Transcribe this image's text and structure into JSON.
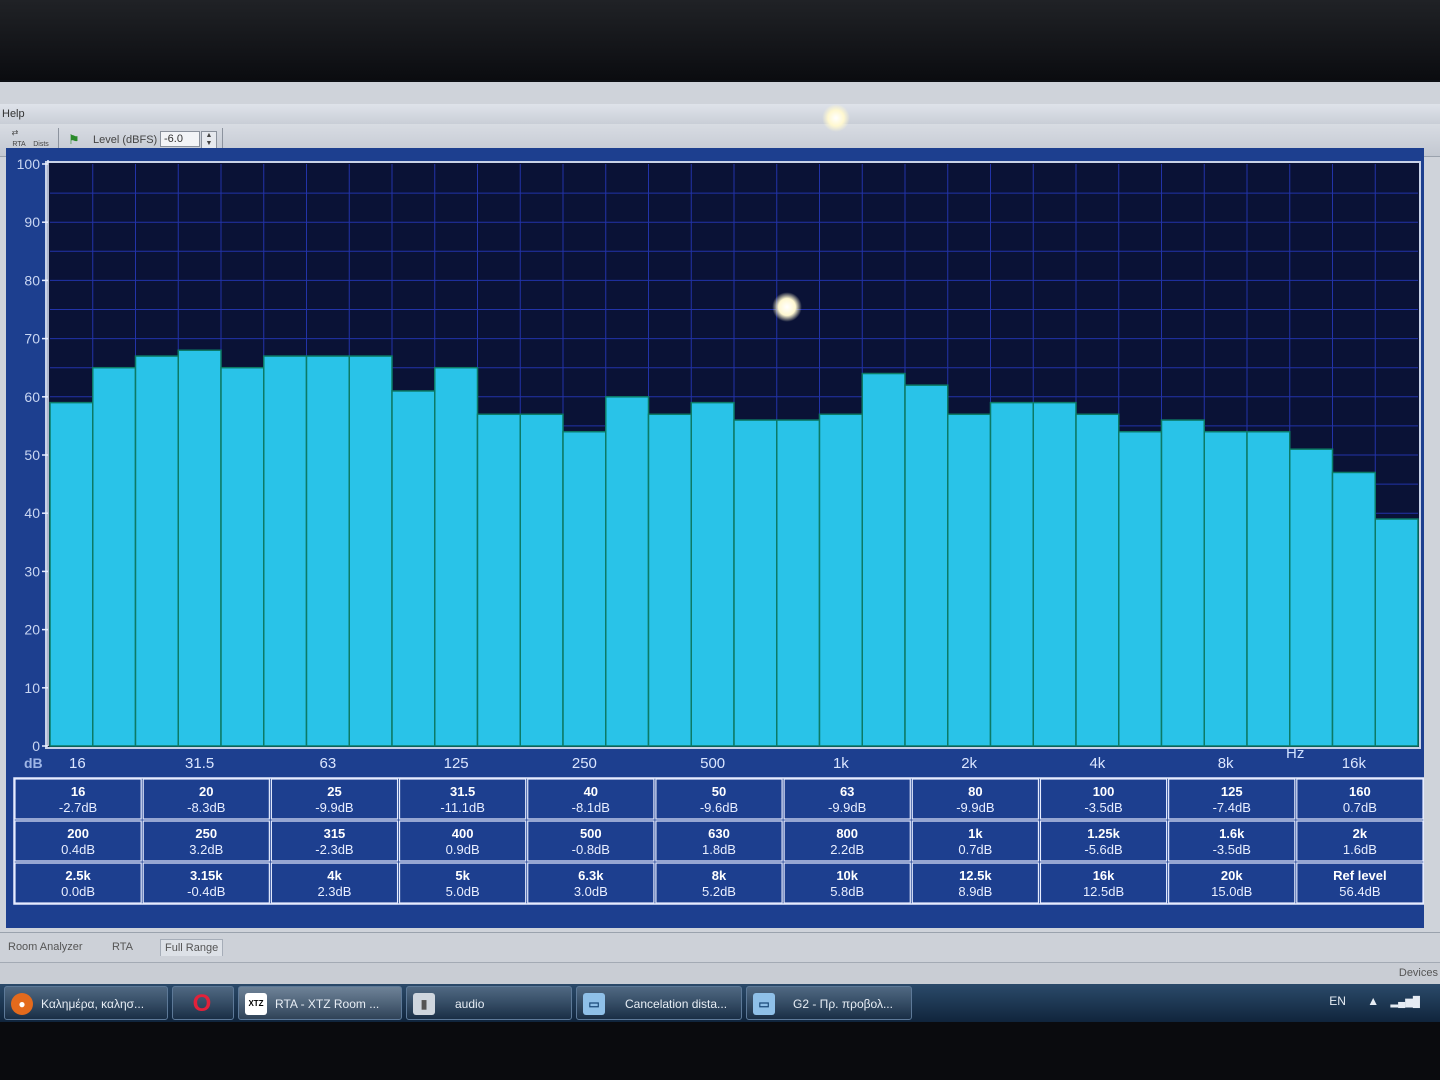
{
  "menu": {
    "help_label": "Help"
  },
  "toolbar": {
    "btn_rta": "RTA",
    "btn_dists": "Dists",
    "level_label": "Level (dBFS)",
    "level_value": "-6.0"
  },
  "chart_data": {
    "type": "bar",
    "ylabel": "dB",
    "xunit": "Hz",
    "ylim": [
      0,
      100
    ],
    "yticks": [
      "0",
      "10",
      "20",
      "30",
      "40",
      "50",
      "60",
      "70",
      "80",
      "90",
      "100"
    ],
    "xtick_labels": [
      "16",
      "31.5",
      "63",
      "125",
      "250",
      "500",
      "1k",
      "2k",
      "4k",
      "8k",
      "16k"
    ],
    "categories": [
      "16",
      "20",
      "25",
      "31.5",
      "40",
      "50",
      "63",
      "80",
      "100",
      "125",
      "160",
      "200",
      "250",
      "315",
      "400",
      "500",
      "630",
      "800",
      "1k",
      "1.25k",
      "1.6k",
      "2k",
      "2.5k",
      "3.15k",
      "4k",
      "5k",
      "6.3k",
      "8k",
      "10k",
      "12.5k",
      "16k",
      "20k"
    ],
    "values": [
      59,
      65,
      67,
      68,
      65,
      67,
      67,
      67,
      61,
      65,
      57,
      57,
      54,
      60,
      57,
      59,
      56,
      56,
      57,
      64,
      62,
      57,
      59,
      59,
      57,
      54,
      56,
      54,
      54,
      51,
      47,
      39
    ],
    "grid": true,
    "legend": "none"
  },
  "eq_table": [
    [
      {
        "freq": "16",
        "db": "-2.7dB"
      },
      {
        "freq": "20",
        "db": "-8.3dB"
      },
      {
        "freq": "25",
        "db": "-9.9dB"
      },
      {
        "freq": "31.5",
        "db": "-11.1dB"
      },
      {
        "freq": "40",
        "db": "-8.1dB"
      },
      {
        "freq": "50",
        "db": "-9.6dB"
      },
      {
        "freq": "63",
        "db": "-9.9dB"
      },
      {
        "freq": "80",
        "db": "-9.9dB"
      },
      {
        "freq": "100",
        "db": "-3.5dB"
      },
      {
        "freq": "125",
        "db": "-7.4dB"
      },
      {
        "freq": "160",
        "db": "0.7dB"
      }
    ],
    [
      {
        "freq": "200",
        "db": "0.4dB"
      },
      {
        "freq": "250",
        "db": "3.2dB"
      },
      {
        "freq": "315",
        "db": "-2.3dB"
      },
      {
        "freq": "400",
        "db": "0.9dB"
      },
      {
        "freq": "500",
        "db": "-0.8dB"
      },
      {
        "freq": "630",
        "db": "1.8dB"
      },
      {
        "freq": "800",
        "db": "2.2dB"
      },
      {
        "freq": "1k",
        "db": "0.7dB"
      },
      {
        "freq": "1.25k",
        "db": "-5.6dB"
      },
      {
        "freq": "1.6k",
        "db": "-3.5dB"
      },
      {
        "freq": "2k",
        "db": "1.6dB"
      }
    ],
    [
      {
        "freq": "2.5k",
        "db": "0.0dB"
      },
      {
        "freq": "3.15k",
        "db": "-0.4dB"
      },
      {
        "freq": "4k",
        "db": "2.3dB"
      },
      {
        "freq": "5k",
        "db": "5.0dB"
      },
      {
        "freq": "6.3k",
        "db": "3.0dB"
      },
      {
        "freq": "8k",
        "db": "5.2dB"
      },
      {
        "freq": "10k",
        "db": "5.8dB"
      },
      {
        "freq": "12.5k",
        "db": "8.9dB"
      },
      {
        "freq": "16k",
        "db": "12.5dB"
      },
      {
        "freq": "20k",
        "db": "15.0dB"
      },
      {
        "freq": "Ref level",
        "db": "56.4dB"
      }
    ]
  ],
  "tabs": [
    "Room Analyzer",
    "RTA",
    "Full Range"
  ],
  "status": {
    "right_text": "Devices"
  },
  "taskbar": {
    "items": [
      "Καλημέρα, καλησ...",
      "",
      "RTA - XTZ Room ...",
      "audio",
      "Cancelation dista...",
      "G2 - Πρ. προβολ..."
    ],
    "lang": "EN",
    "xtz_badge": "XTZ"
  },
  "colors": {
    "bar_fill": "#29c3e8",
    "plot_bg": "#0a1236",
    "grid": "#2233a8",
    "table_bg": "#1d3f8f"
  }
}
